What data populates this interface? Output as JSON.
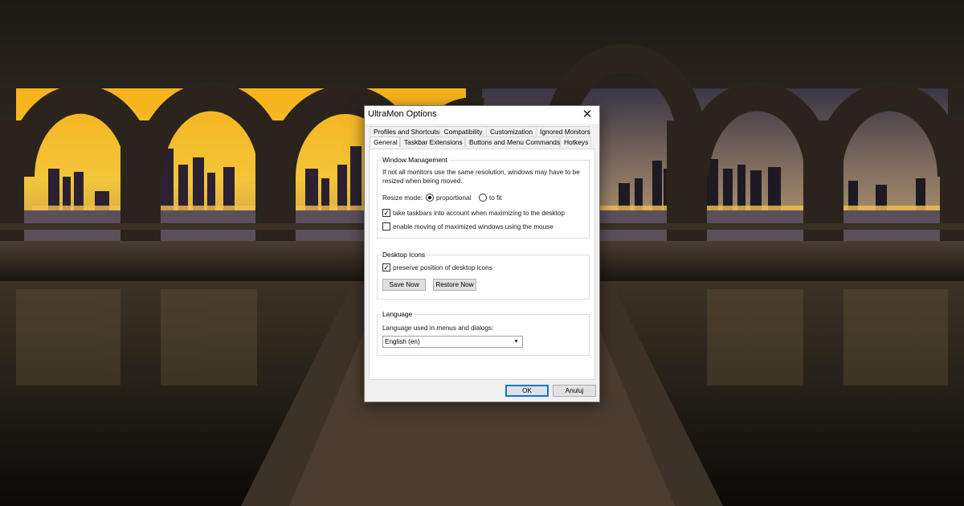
{
  "dialog": {
    "title": "UltraMon Options",
    "close_glyph": "✕",
    "tabs_row1": [
      "Profiles and Shortcuts",
      "Compatibility",
      "Customization",
      "Ignored Monitors"
    ],
    "tabs_row2": [
      "General",
      "Taskbar Extensions",
      "Buttons and Menu Commands",
      "Hotkeys"
    ],
    "active_tab": "General"
  },
  "window_management": {
    "label": "Window Management",
    "info": "If not all monitors use the same resolution, windows may have to be resized when being moved.",
    "resize_mode_label": "Resize mode:",
    "resize_options": [
      "proportional",
      "to fit"
    ],
    "resize_selected": "proportional",
    "taskbars_label": "take taskbars into account when maximizing to the desktop",
    "taskbars_checked": true,
    "moving_label": "enable moving of maximized windows using the mouse",
    "moving_checked": false
  },
  "desktop_icons": {
    "label": "Desktop Icons",
    "preserve_label": "preserve position of desktop icons",
    "preserve_checked": true,
    "save_button": "Save Now",
    "restore_button": "Restore Now"
  },
  "language": {
    "label": "Language",
    "prompt": "Language used in menus and dialogs:",
    "selected": "English (en)"
  },
  "footer": {
    "ok_button": "OK",
    "cancel_button": "Anuluj"
  },
  "icons": {
    "check": "✓",
    "dropdown": "chevron-down-icon"
  }
}
